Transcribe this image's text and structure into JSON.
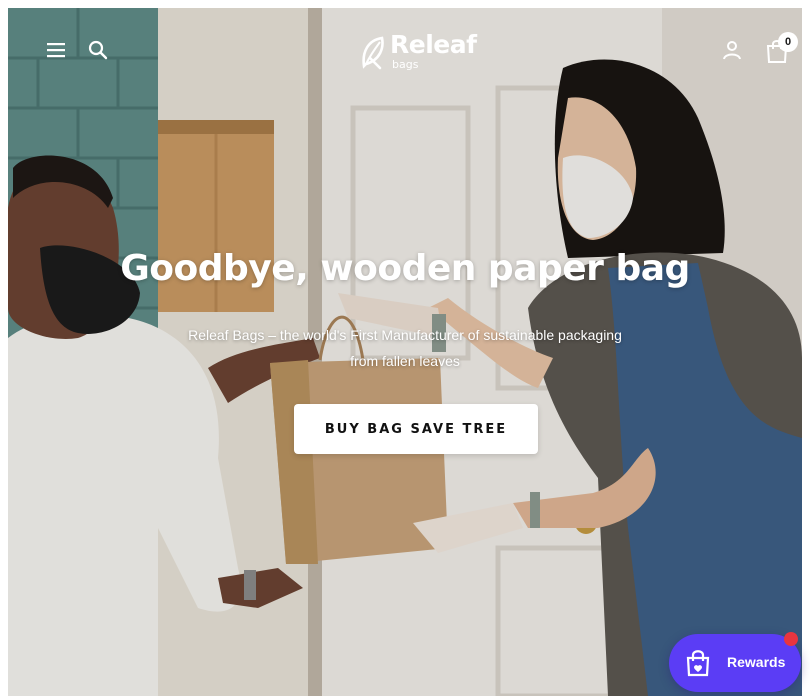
{
  "header": {
    "logo_text": "Releaf",
    "logo_subtext": "bags",
    "cart_count": "0",
    "icons": [
      "menu-icon",
      "search-icon",
      "leaf-logo-icon",
      "user-icon",
      "shopping-bag-icon"
    ]
  },
  "hero": {
    "headline": "Goodbye, wooden paper bag",
    "subtext_line1": "Releaf Bags – the world's First Manufacturer of sustainable packaging",
    "subtext_line2": "from fallen leaves",
    "cta_label": "BUY BAG SAVE TREE"
  },
  "rewards": {
    "label": "Rewards",
    "icon": "gift-bag-icon"
  },
  "colors": {
    "accent": "#5b3df5",
    "notification": "#e8353f",
    "cta_background": "#ffffff",
    "cta_text": "#111111"
  }
}
